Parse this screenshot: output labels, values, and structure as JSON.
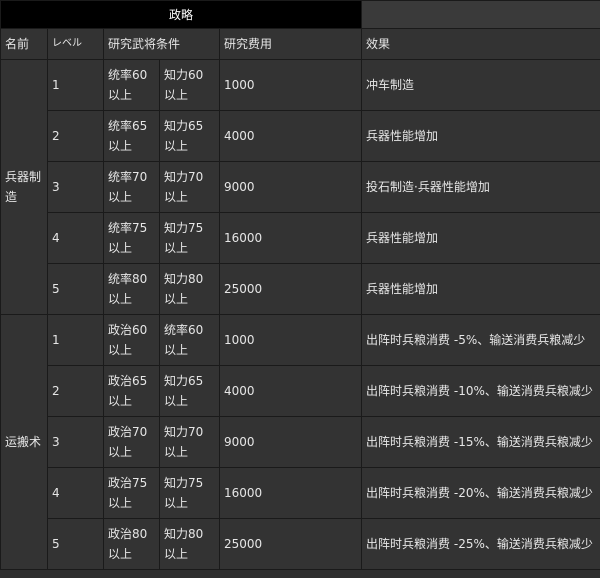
{
  "title": "政略",
  "headers": {
    "name": "名前",
    "level": "レベル",
    "condition": "研究武将条件",
    "cost": "研究费用",
    "effect": "效果"
  },
  "groups": [
    {
      "name": "兵器制造",
      "rows": [
        {
          "level": "1",
          "cond1": "统率60以上",
          "cond2": "知力60以上",
          "cost": "1000",
          "effect": "冲车制造"
        },
        {
          "level": "2",
          "cond1": "统率65以上",
          "cond2": "知力65以上",
          "cost": "4000",
          "effect": "兵器性能增加"
        },
        {
          "level": "3",
          "cond1": "统率70以上",
          "cond2": "知力70以上",
          "cost": "9000",
          "effect": "投石制造·兵器性能增加"
        },
        {
          "level": "4",
          "cond1": "统率75以上",
          "cond2": "知力75以上",
          "cost": "16000",
          "effect": "兵器性能增加"
        },
        {
          "level": "5",
          "cond1": "统率80以上",
          "cond2": "知力80以上",
          "cost": "25000",
          "effect": "兵器性能增加"
        }
      ]
    },
    {
      "name": "运搬术",
      "rows": [
        {
          "level": "1",
          "cond1": "政治60以上",
          "cond2": "统率60以上",
          "cost": "1000",
          "effect": "出阵时兵粮消费 -5%、输送消费兵粮减少"
        },
        {
          "level": "2",
          "cond1": "政治65以上",
          "cond2": "知力65以上",
          "cost": "4000",
          "effect": "出阵时兵粮消费 -10%、输送消费兵粮减少"
        },
        {
          "level": "3",
          "cond1": "政治70以上",
          "cond2": "知力70以上",
          "cost": "9000",
          "effect": "出阵时兵粮消费 -15%、输送消费兵粮减少"
        },
        {
          "level": "4",
          "cond1": "政治75以上",
          "cond2": "知力75以上",
          "cost": "16000",
          "effect": "出阵时兵粮消费 -20%、输送消费兵粮减少"
        },
        {
          "level": "5",
          "cond1": "政治80以上",
          "cond2": "知力80以上",
          "cost": "25000",
          "effect": "出阵时兵粮消费 -25%、输送消费兵粮减少"
        }
      ]
    }
  ]
}
